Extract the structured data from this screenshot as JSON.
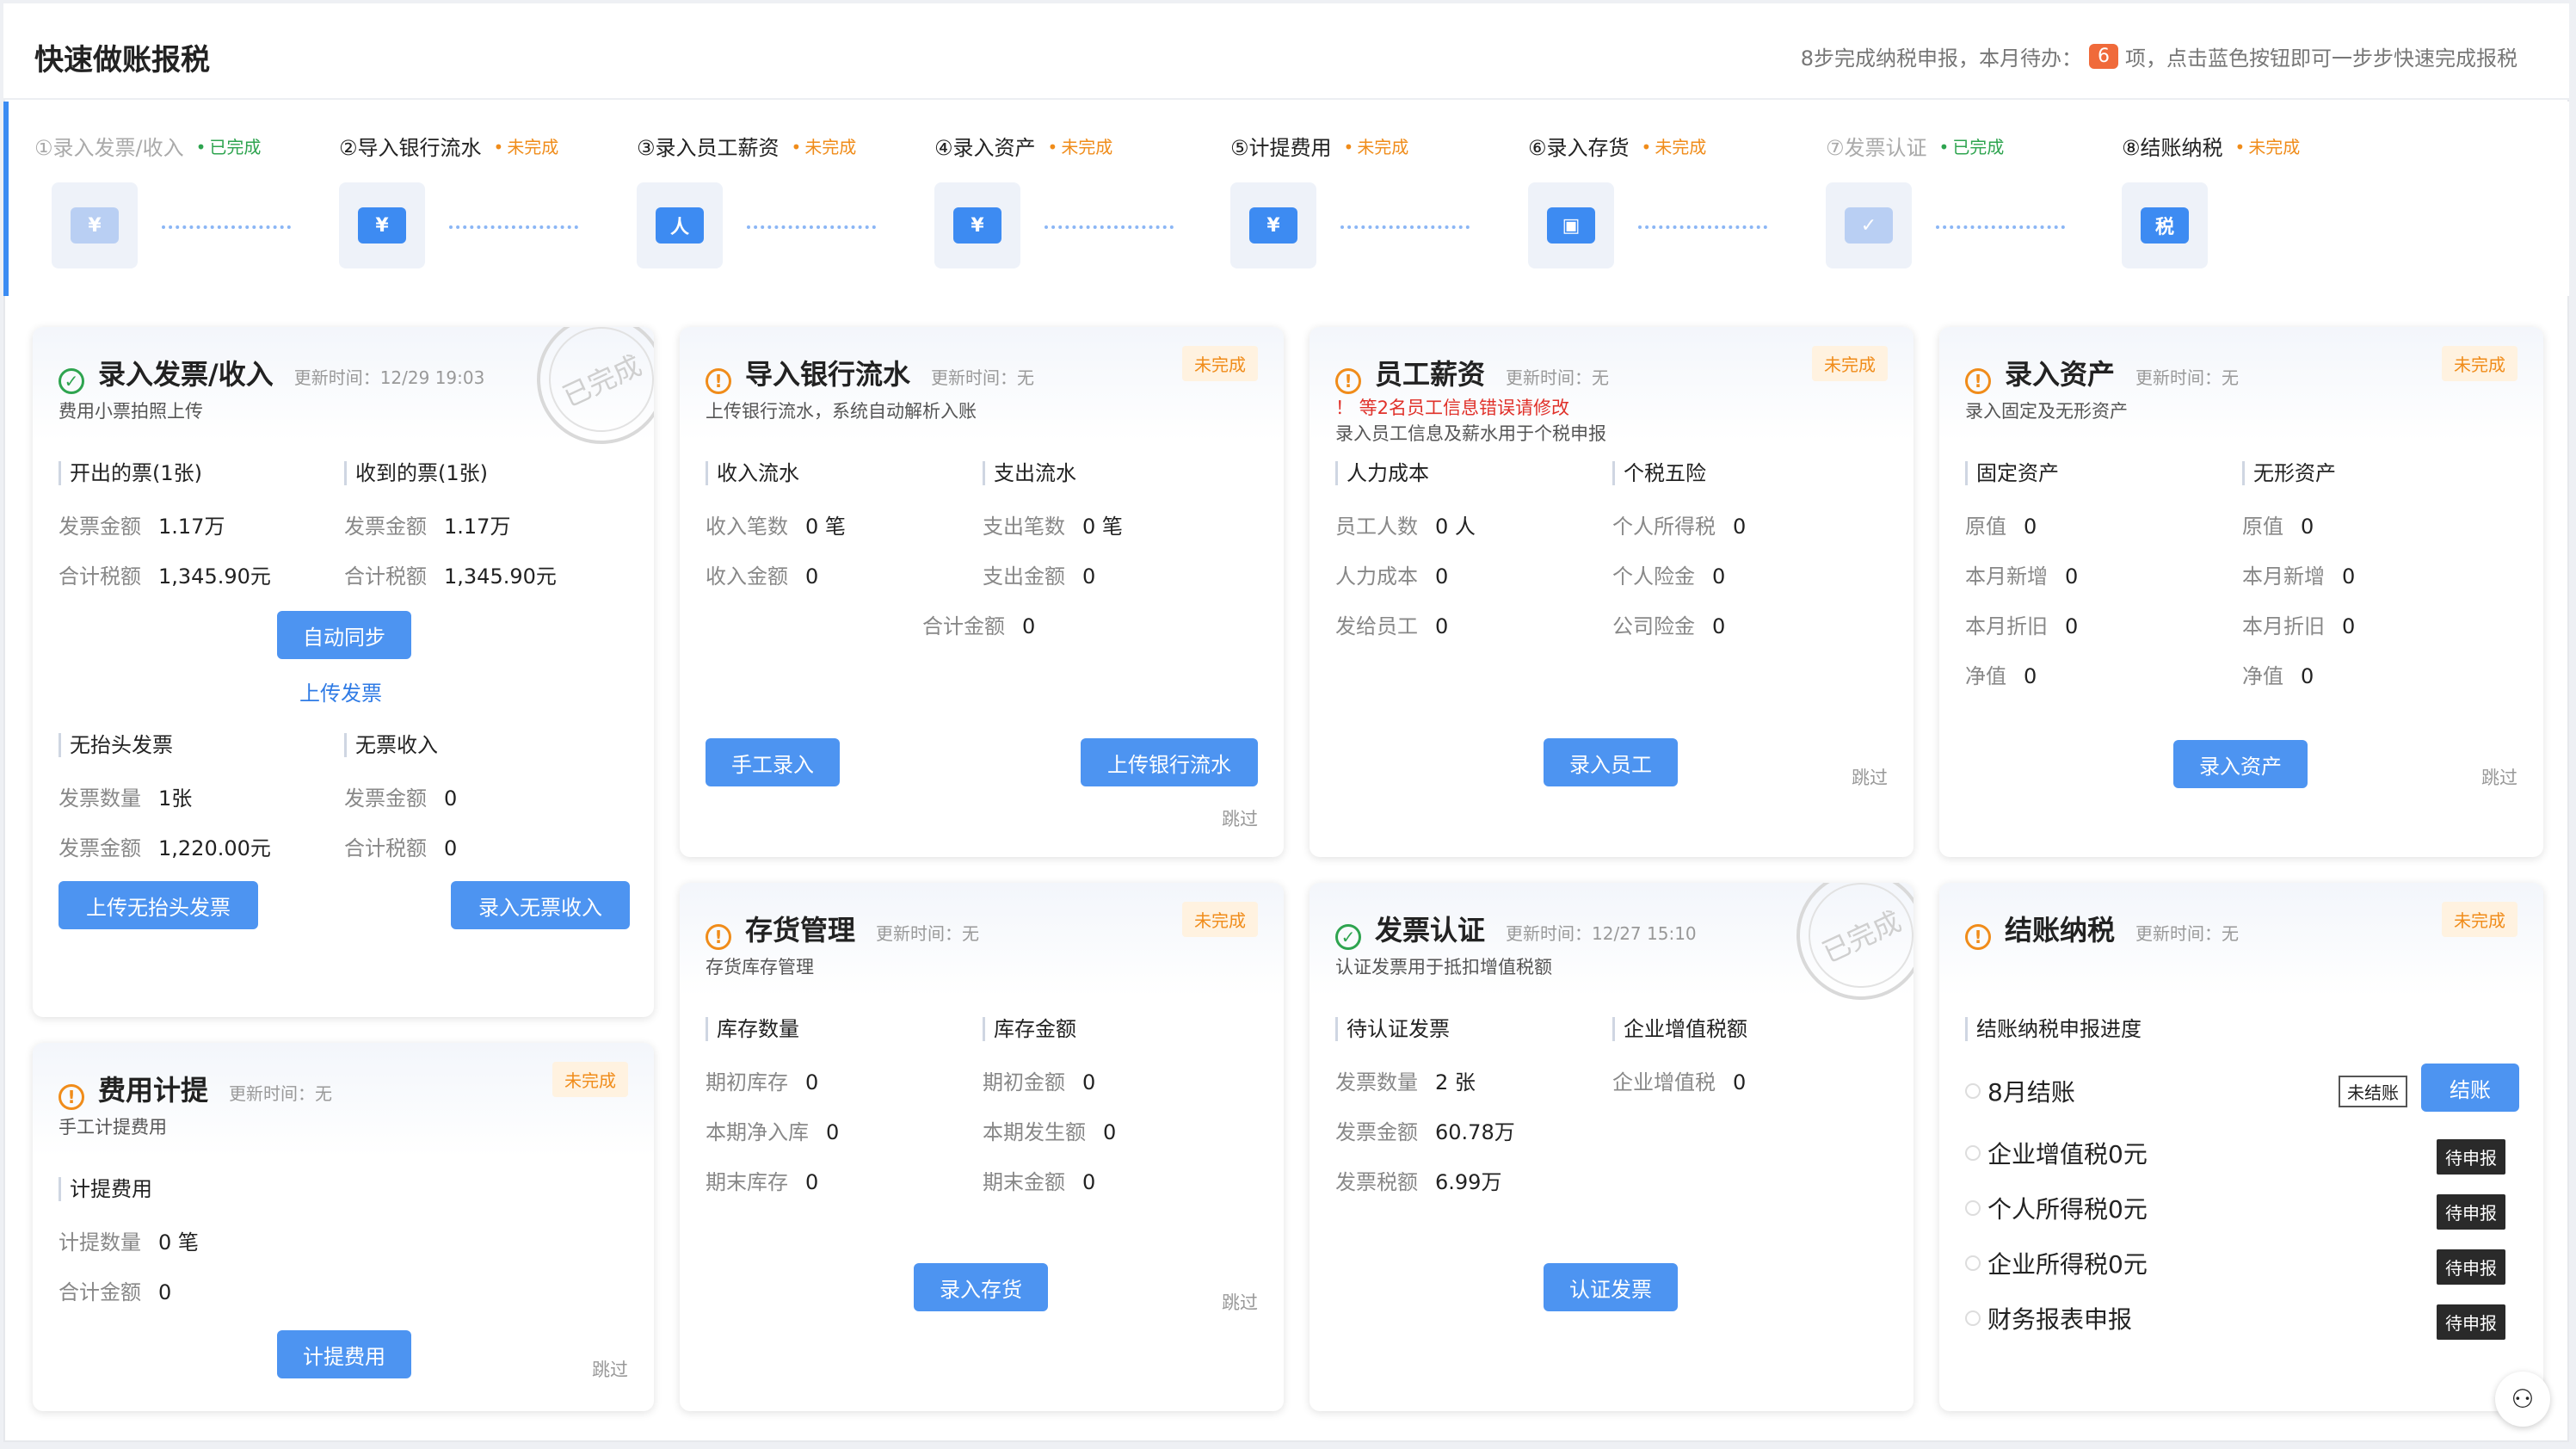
{
  "header": {
    "title": "快速做账报税",
    "info_prefix": "8步完成纳税申报，本月待办：",
    "pending_count": "6",
    "info_suffix": "项，点击蓝色按钮即可一步步快速完成报税"
  },
  "steps": [
    {
      "label": "①录入发票/收入",
      "status": "已完成",
      "icon": "invoice-icon",
      "glyph": "¥"
    },
    {
      "label": "②导入银行流水",
      "status": "未完成",
      "icon": "bank-card-icon",
      "glyph": "¥"
    },
    {
      "label": "③录入员工薪资",
      "status": "未完成",
      "icon": "employee-icon",
      "glyph": "人"
    },
    {
      "label": "④录入资产",
      "status": "未完成",
      "icon": "wallet-icon",
      "glyph": "¥"
    },
    {
      "label": "⑤计提费用",
      "status": "未完成",
      "icon": "expense-icon",
      "glyph": "¥"
    },
    {
      "label": "⑥录入存货",
      "status": "未完成",
      "icon": "inventory-box-icon",
      "glyph": "▣"
    },
    {
      "label": "⑦发票认证",
      "status": "已完成",
      "icon": "invoice-verify-icon",
      "glyph": "✓"
    },
    {
      "label": "⑧结账纳税",
      "status": "未完成",
      "icon": "tax-icon",
      "glyph": "税"
    }
  ],
  "stamp_text": "已完成",
  "cards": {
    "invoice": {
      "title": "录入发票/收入",
      "updated": "更新时间：12/29 19:03",
      "sub": "费用小票拍照上传",
      "issued_title": "开出的票(1张)",
      "received_title": "收到的票(1张)",
      "issued_amount_label": "发票金额",
      "issued_amount": "1.17万",
      "issued_tax_label": "合计税额",
      "issued_tax": "1,345.90元",
      "received_amount_label": "发票金额",
      "received_amount": "1.17万",
      "received_tax_label": "合计税额",
      "received_tax": "1,345.90元",
      "sync_btn": "自动同步",
      "upload_link": "上传发票",
      "notitle_title": "无抬头发票",
      "noinvoice_title": "无票收入",
      "notitle_count_label": "发票数量",
      "notitle_count": "1张",
      "notitle_amount_label": "发票金额",
      "notitle_amount": "1,220.00元",
      "noinvoice_amount_label": "发票金额",
      "noinvoice_amount": "0",
      "noinvoice_tax_label": "合计税额",
      "noinvoice_tax": "0",
      "btn_upload_notitle": "上传无抬头发票",
      "btn_noinvoice": "录入无票收入"
    },
    "bank": {
      "title": "导入银行流水",
      "updated": "更新时间：无",
      "sub": "上传银行流水，系统自动解析入账",
      "tag": "未完成",
      "in_title": "收入流水",
      "out_title": "支出流水",
      "in_count_label": "收入笔数",
      "in_count": "0 笔",
      "in_amount_label": "收入金额",
      "in_amount": "0",
      "out_count_label": "支出笔数",
      "out_count": "0 笔",
      "out_amount_label": "支出金额",
      "out_amount": "0",
      "total_label": "合计金额",
      "total": "0",
      "btn_manual": "手工录入",
      "btn_upload": "上传银行流水",
      "skip": "跳过"
    },
    "salary": {
      "title": "员工薪资",
      "updated": "更新时间：无",
      "error": "！ 等2名员工信息错误请修改",
      "sub": "录入员工信息及薪水用于个税申报",
      "tag": "未完成",
      "labor_title": "人力成本",
      "tax_title": "个税五险",
      "staff_label": "员工人数",
      "staff": "0 人",
      "cost_label": "人力成本",
      "cost": "0",
      "paid_label": "发给员工",
      "paid": "0",
      "iit_label": "个人所得税",
      "iit": "0",
      "personal_ins_label": "个人险金",
      "personal_ins": "0",
      "company_ins_label": "公司险金",
      "company_ins": "0",
      "btn": "录入员工",
      "skip": "跳过"
    },
    "asset": {
      "title": "录入资产",
      "updated": "更新时间：无",
      "sub": "录入固定及无形资产",
      "tag": "未完成",
      "fixed_title": "固定资产",
      "intangible_title": "无形资产",
      "rows": [
        {
          "label": "原值",
          "value": "0"
        },
        {
          "label": "本月新增",
          "value": "0"
        },
        {
          "label": "本月折旧",
          "value": "0"
        },
        {
          "label": "净值",
          "value": "0"
        }
      ],
      "btn": "录入资产",
      "skip": "跳过"
    },
    "expense": {
      "title": "费用计提",
      "updated": "更新时间：无",
      "sub": "手工计提费用",
      "tag": "未完成",
      "sec_title": "计提费用",
      "count_label": "计提数量",
      "count": "0 笔",
      "amount_label": "合计金额",
      "amount": "0",
      "btn": "计提费用",
      "skip": "跳过"
    },
    "inventory": {
      "title": "存货管理",
      "updated": "更新时间：无",
      "sub": "存货库存管理",
      "tag": "未完成",
      "qty_title": "库存数量",
      "amt_title": "库存金额",
      "q_open_label": "期初库存",
      "q_open": "0",
      "q_in_label": "本期净入库",
      "q_in": "0",
      "q_end_label": "期末库存",
      "q_end": "0",
      "a_open_label": "期初金额",
      "a_open": "0",
      "a_occ_label": "本期发生额",
      "a_occ": "0",
      "a_end_label": "期末金额",
      "a_end": "0",
      "btn": "录入存货",
      "skip": "跳过"
    },
    "verify": {
      "title": "发票认证",
      "updated": "更新时间：12/27 15:10",
      "sub": "认证发票用于抵扣增值税额",
      "pending_title": "待认证发票",
      "vat_title": "企业增值税额",
      "count_label": "发票数量",
      "count": "2 张",
      "amount_label": "发票金额",
      "amount": "60.78万",
      "tax_label": "发票税额",
      "tax": "6.99万",
      "vat_label": "企业增值税",
      "vat": "0",
      "btn": "认证发票"
    },
    "close": {
      "title": "结账纳税",
      "updated": "更新时间：无",
      "tag": "未完成",
      "sec_title": "结账纳税申报进度",
      "month_label": "8月结账",
      "unclosed": "未结账",
      "btn": "结账",
      "items": [
        {
          "label": "企业增值税0元",
          "status": "待申报"
        },
        {
          "label": "个人所得税0元",
          "status": "待申报"
        },
        {
          "label": "企业所得税0元",
          "status": "待申报"
        },
        {
          "label": "财务报表申报",
          "status": "待申报"
        }
      ]
    }
  }
}
